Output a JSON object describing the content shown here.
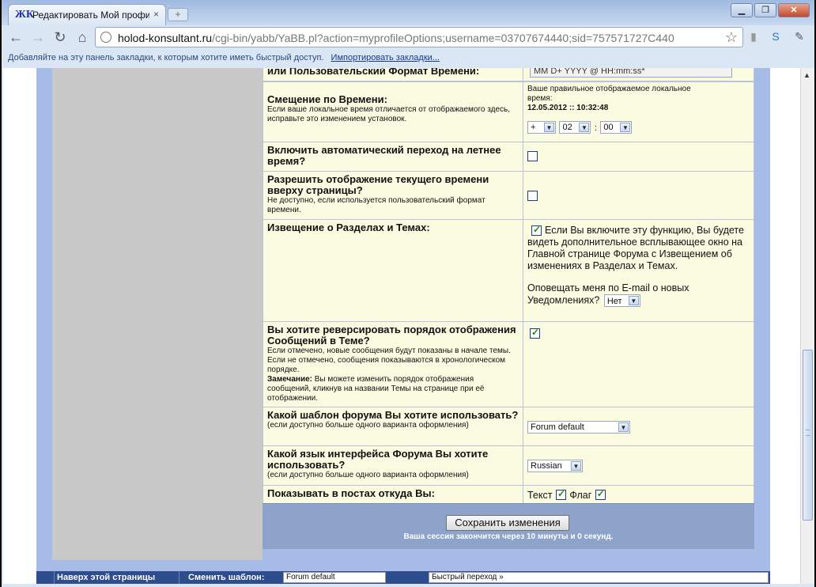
{
  "browser": {
    "tab_title": "Редактировать Мой профил",
    "tab_close": "×",
    "newtab": "+",
    "favicon_letters": "ЖК",
    "url_domain": "holod-konsultant.ru",
    "url_path": "/cgi-bin/yabb/YaBB.pl?action=myprofileOptions;username=03707674440;sid=757571727C440",
    "bookmarks_text": "Добавляйте на эту панель закладки, к которым хотите иметь быстрый доступ.",
    "bookmarks_link": "Импортировать закладки...",
    "win_min": "▁",
    "win_max": "❐",
    "win_close": "✕"
  },
  "form": {
    "row_format": {
      "label": "или Пользовательский Формат Времени:",
      "value": "MM D+ YYYY @ HH:mm:ss*"
    },
    "row_offset": {
      "label": "Смещение по Времени:",
      "note": "Если ваше локальное время отличается от отображаемого здесь, исправьте это изменением установок.",
      "right_note": "Ваше правильное отображаемое локальное время:",
      "right_time": "12.05.2012 :: 10:32:48",
      "sign": "+",
      "hours": "02",
      "colon": ":",
      "minutes": "00"
    },
    "row_dst": {
      "label": "Включить автоматический переход на летнее время?"
    },
    "row_show_time": {
      "label": "Разрешить отображение текущего времени вверху страницы?",
      "note": "Не доступно, если используется пользовательский формат времени."
    },
    "row_notify": {
      "label": "Извещение о Разделах и Темах:",
      "text": "Если Вы включите эту функцию, Вы будете видеть дополнительное всплывающее окно на Главной странице Форума с Извещением об изменениях в Разделах и Темах.",
      "email_text": "Оповещать меня по E-mail о новых Уведомлениях?",
      "email_value": "Нет"
    },
    "row_reverse": {
      "label": "Вы хотите реверсировать порядок отображения Сообщений в Теме?",
      "note": "Если отмечено, новые сообщения будут показаны в начале темы. Если не отмечено, сообщения показываются в хронологическом порядке.",
      "note_bold": "Замечание:",
      "note2": " Вы можете изменить порядок отображения сообщений, кликнув на названии Темы на странице при её отображении."
    },
    "row_template": {
      "label": "Какой шаблон форума Вы хотите использовать?",
      "note": "(если доступно больше одного варианта оформления)",
      "value": "Forum default"
    },
    "row_language": {
      "label": "Какой язык интерфейса Форума Вы хотите использовать?",
      "note": "(если доступно больше одного варианта оформления)",
      "value": "Russian"
    },
    "row_location": {
      "label": "Показывать в постах откуда Вы:",
      "text_label": "Текст",
      "flag_label": "Флаг"
    },
    "save_button": "Сохранить изменения",
    "session_text": "Ваша сессия закончится через 10 минуты и 0 секунд."
  },
  "bottom": {
    "top_link": "Наверх этой страницы",
    "change_template": "Сменить шаблон:",
    "template_value": "Forum default",
    "quick_jump": "Быстрый переход »"
  },
  "checks": {
    "dst": false,
    "show_time": false,
    "notify": true,
    "reverse": true,
    "loc_text": true,
    "loc_flag": true
  }
}
